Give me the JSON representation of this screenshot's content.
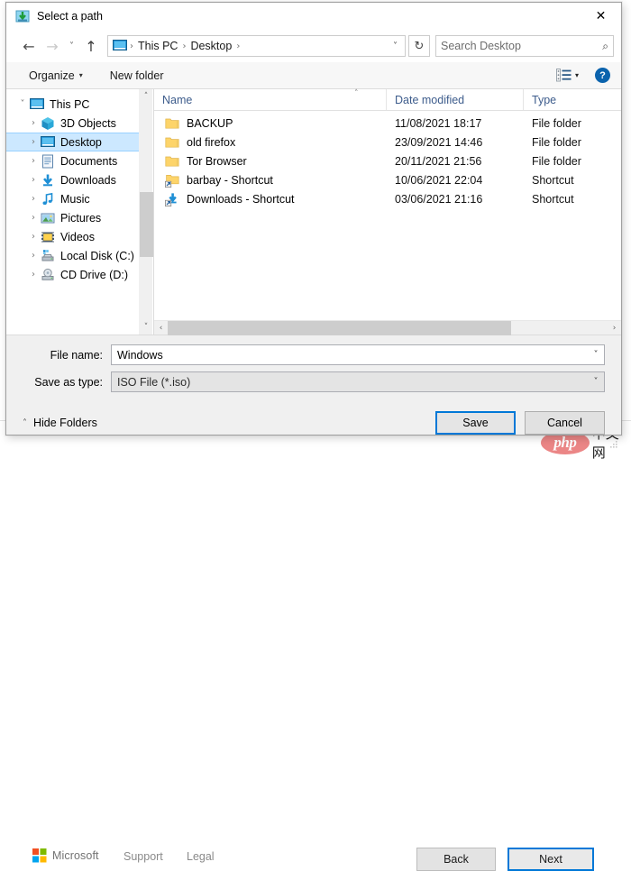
{
  "dialog": {
    "title": "Select a path",
    "title_icon": "save-arrow-icon",
    "close_label": "✕"
  },
  "nav": {
    "back": "←",
    "forward": "→",
    "history": "˅",
    "up": "↑",
    "refresh": "↻",
    "address_chevron": "˅",
    "breadcrumbs": [
      "This PC",
      "Desktop"
    ],
    "separator": "›"
  },
  "search": {
    "placeholder": "Search Desktop",
    "icon": "⌕"
  },
  "toolbar": {
    "organize": "Organize",
    "organize_caret": "▾",
    "new_folder": "New folder",
    "view_caret": "▾",
    "help": "?"
  },
  "sidebar": {
    "items": [
      {
        "label": "This PC",
        "level": 0,
        "twisty": "˅",
        "icon": "monitor-icon",
        "selected": false
      },
      {
        "label": "3D Objects",
        "level": 1,
        "twisty": "›",
        "icon": "cube-icon",
        "selected": false
      },
      {
        "label": "Desktop",
        "level": 1,
        "twisty": "›",
        "icon": "monitor-icon",
        "selected": true
      },
      {
        "label": "Documents",
        "level": 1,
        "twisty": "›",
        "icon": "documents-icon",
        "selected": false
      },
      {
        "label": "Downloads",
        "level": 1,
        "twisty": "›",
        "icon": "downloads-icon",
        "selected": false
      },
      {
        "label": "Music",
        "level": 1,
        "twisty": "›",
        "icon": "music-icon",
        "selected": false
      },
      {
        "label": "Pictures",
        "level": 1,
        "twisty": "›",
        "icon": "pictures-icon",
        "selected": false
      },
      {
        "label": "Videos",
        "level": 1,
        "twisty": "›",
        "icon": "videos-icon",
        "selected": false
      },
      {
        "label": "Local Disk (C:)",
        "level": 1,
        "twisty": "›",
        "icon": "harddisk-icon",
        "selected": false
      },
      {
        "label": "CD Drive (D:)",
        "level": 1,
        "twisty": "›",
        "icon": "cddrive-icon",
        "selected": false
      }
    ],
    "scroll_up": "˄",
    "scroll_down": "˅"
  },
  "filelist": {
    "columns": [
      "Name",
      "Date modified",
      "Type"
    ],
    "sort_caret": "˄",
    "rows": [
      {
        "name": "BACKUP",
        "date": "11/08/2021 18:17",
        "type": "File folder",
        "icon": "folder-icon"
      },
      {
        "name": "old firefox",
        "date": "23/09/2021 14:46",
        "type": "File folder",
        "icon": "folder-icon"
      },
      {
        "name": "Tor Browser",
        "date": "20/11/2021 21:56",
        "type": "File folder",
        "icon": "folder-icon"
      },
      {
        "name": "barbay - Shortcut",
        "date": "10/06/2021 22:04",
        "type": "Shortcut",
        "icon": "folder-shortcut-icon"
      },
      {
        "name": "Downloads - Shortcut",
        "date": "03/06/2021 21:16",
        "type": "Shortcut",
        "icon": "downloads-shortcut-icon"
      }
    ],
    "hscroll_left": "‹",
    "hscroll_right": "›"
  },
  "form": {
    "filename_label": "File name:",
    "filename_value": "Windows",
    "savetype_label": "Save as type:",
    "savetype_value": "ISO File (*.iso)",
    "dropdown_caret": "˅"
  },
  "actions": {
    "hide_folders": "Hide Folders",
    "hide_folders_caret": "˄",
    "save": "Save",
    "cancel": "Cancel"
  },
  "background": {
    "brand": "Microsoft",
    "support": "Support",
    "legal": "Legal",
    "back": "Back",
    "next": "Next",
    "watermark_logo": "php",
    "watermark_text": "中文网"
  },
  "colors": {
    "accent": "#0078d7",
    "selection": "#cce8ff",
    "column_header_text": "#3d5c8c",
    "folder": "#fdd46a"
  }
}
